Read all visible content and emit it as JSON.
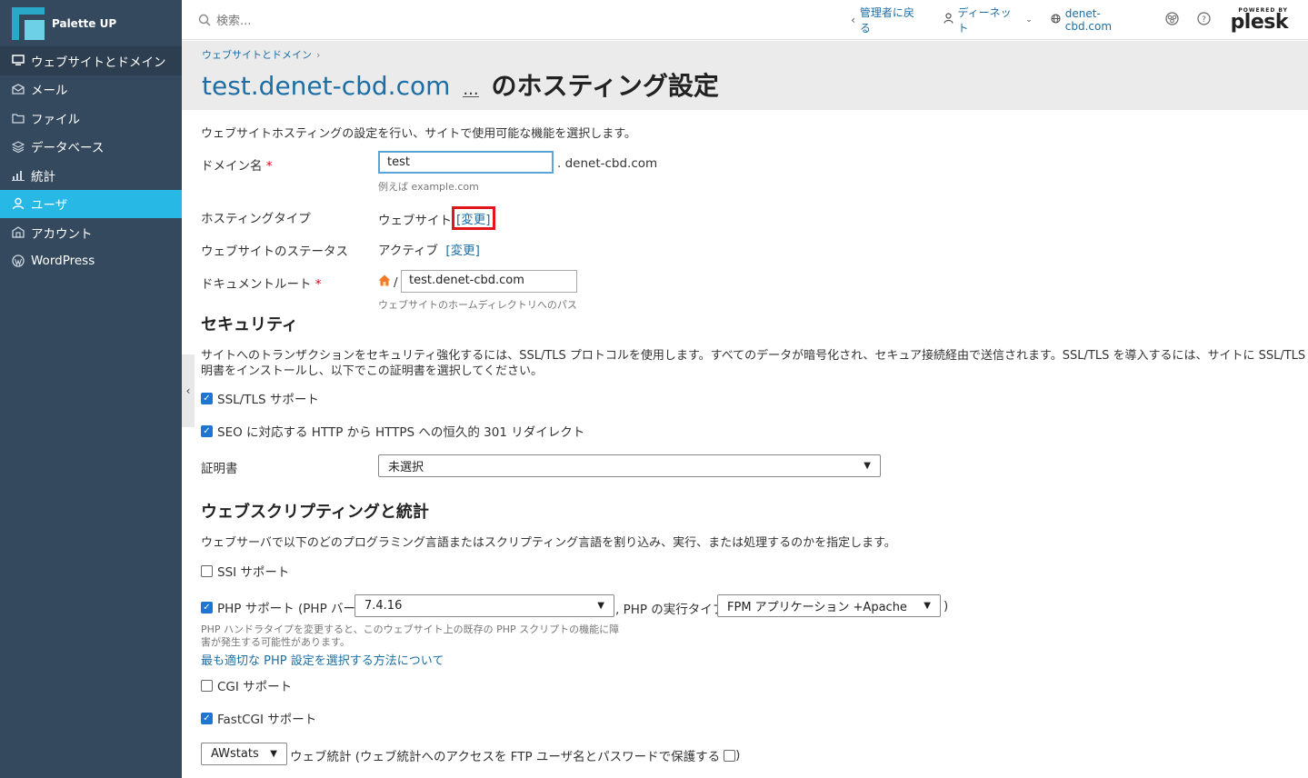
{
  "brand": {
    "name": "Palette UP"
  },
  "sidebar": {
    "items": [
      {
        "label": "ウェブサイトとドメイン",
        "icon": "monitor-icon"
      },
      {
        "label": "メール",
        "icon": "mail-icon"
      },
      {
        "label": "ファイル",
        "icon": "folder-icon"
      },
      {
        "label": "データベース",
        "icon": "database-icon"
      },
      {
        "label": "統計",
        "icon": "bar-chart-icon"
      },
      {
        "label": "ユーザ",
        "icon": "user-icon"
      },
      {
        "label": "アカウント",
        "icon": "account-icon"
      },
      {
        "label": "WordPress",
        "icon": "wordpress-icon"
      }
    ],
    "collapse_glyph": "‹"
  },
  "topbar": {
    "search_placeholder": "検索...",
    "back_label": "管理者に戻る",
    "user_label": "ディーネット",
    "domain_label": "denet-cbd.com",
    "plesk_powered": "POWERED BY",
    "plesk_name": "plesk"
  },
  "header": {
    "breadcrumb": "ウェブサイトとドメイン",
    "breadcrumb_sep": "›",
    "title_domain": "test.denet-cbd.com",
    "title_dots": "...",
    "title_rest": "のホスティング設定"
  },
  "form": {
    "intro": "ウェブサイトホスティングの設定を行い、サイトで使用可能な機能を選択します。",
    "domain_label": "ドメイン名",
    "required_mark": "*",
    "domain_value": "test",
    "domain_suffix": ". denet-cbd.com",
    "domain_hint": "例えば example.com",
    "hosting_type_label": "ホスティングタイプ",
    "hosting_type_value": "ウェブサイト",
    "change_link": "[変更]",
    "status_label": "ウェブサイトのステータス",
    "status_value": "アクティブ",
    "docroot_label": "ドキュメントルート",
    "docroot_slash": "/",
    "docroot_value": "test.denet-cbd.com",
    "docroot_hint": "ウェブサイトのホームディレクトリへのパス"
  },
  "security": {
    "title": "セキュリティ",
    "desc_line1": "サイトへのトランザクションをセキュリティ強化するには、SSL/TLS プロトコルを使用します。すべてのデータが暗号化され、セキュア接続経由で送信されます。SSL/TLS を導入するには、サイトに SSL/TLS 証",
    "desc_line2": "明書をインストールし、以下でこの証明書を選択してください。",
    "ssl_label": "SSL/TLS サポート",
    "ssl_checked": true,
    "seo_label": "SEO に対応する HTTP から HTTPS への恒久的 301 リダイレクト",
    "seo_checked": true,
    "cert_label": "証明書",
    "cert_value": "未選択"
  },
  "scripting": {
    "title": "ウェブスクリプティングと統計",
    "desc": "ウェブサーバで以下のどのプログラミング言語またはスクリプティング言語を割り込み、実行、または処理するのかを指定します。",
    "ssi_label": "SSI サポート",
    "ssi_checked": false,
    "php_label": "PHP サポート (PHP バージョン",
    "php_checked": true,
    "php_version": "7.4.16",
    "php_exec_label": ", PHP の実行タイプ",
    "php_exec_value": "FPM アプリケーション +Apache",
    "php_close": ")",
    "php_hint_line1": "PHP ハンドラタイプを変更すると、このウェブサイト上の既存の PHP スクリプトの機能に障",
    "php_hint_line2": "害が発生する可能性があります。",
    "php_link": "最も適切な PHP 設定を選択する方法について",
    "cgi_label": "CGI サポート",
    "cgi_checked": false,
    "fastcgi_label": "FastCGI サポート",
    "fastcgi_checked": true,
    "stats_value": "AWstats",
    "stats_label": "ウェブ統計 (ウェブ統計へのアクセスを FTP ユーザ名とパスワードで保護する",
    "stats_close": ")"
  },
  "colors": {
    "sidebar_bg": "#35495e",
    "sidebar_active": "#28b8e6",
    "link": "#1c6ea4",
    "highlight_box": "#e3141b"
  }
}
